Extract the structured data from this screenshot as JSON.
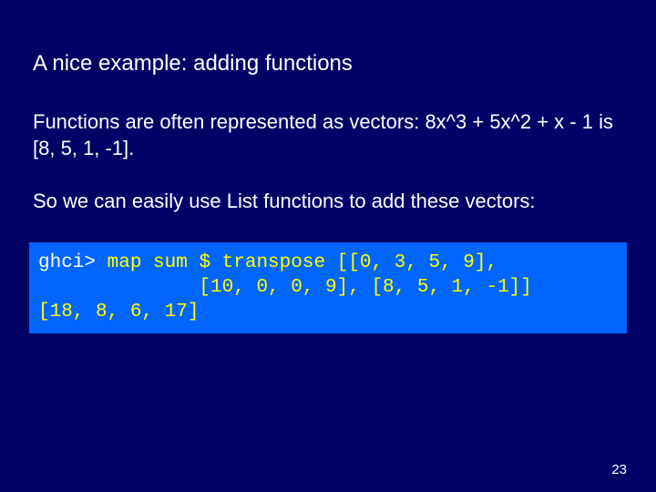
{
  "title": "A nice example: adding functions",
  "para1": "Functions are often represented as vectors: 8x^3 + 5x^2 + x - 1 is [8, 5, 1, -1].",
  "para2": "So we can easily use List functions to add these vectors:",
  "code": {
    "prompt": "ghci> ",
    "l1a": "map sum $ transpose [[0, 3, 5, 9],",
    "l2": "              [10, 0, 0, 9], [8, 5, 1, -1]]",
    "l3": "[18, 8, 6, 17]"
  },
  "page": "23"
}
